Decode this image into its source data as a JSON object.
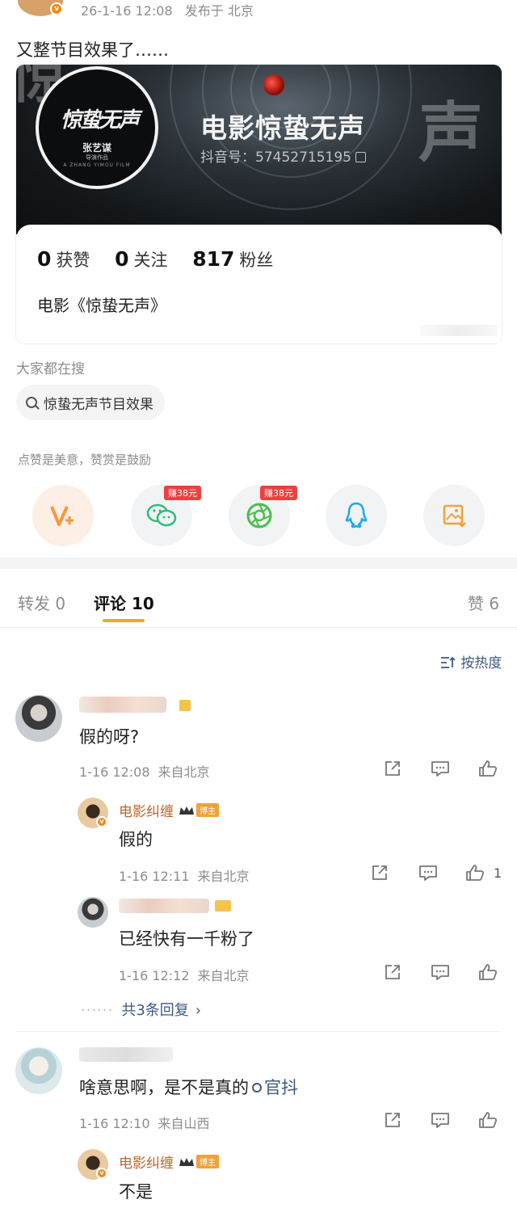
{
  "post": {
    "date": "26-1-16 12:08",
    "location": "发布于 北京",
    "text": "又整节目效果了……"
  },
  "card": {
    "logo_title": "惊蛰无声",
    "logo_director": "张艺谋",
    "logo_subtitle": "导演作品",
    "logo_en": "A ZHANG YIMOU FILM",
    "account_name": "电影惊蛰无声",
    "account_id": "抖音号：57452715195",
    "stats": [
      {
        "value": "0",
        "label": "获赞"
      },
      {
        "value": "0",
        "label": "关注"
      },
      {
        "value": "817",
        "label": "粉丝"
      }
    ],
    "description": "电影《惊蛰无声》"
  },
  "search": {
    "label": "大家都在搜",
    "query": "惊蛰无声节目效果"
  },
  "reward": {
    "text": "点赞是美意，赞赏是鼓励",
    "earn_badge": "赚38元",
    "buttons": [
      "v-plus-icon",
      "wechat-icon",
      "moments-icon",
      "qq-icon",
      "save-image-icon"
    ]
  },
  "tabs": {
    "repost": "转发 0",
    "comments": "评论 10",
    "likes": "赞 6"
  },
  "sort_label": "按热度",
  "comments": [
    {
      "text": "假的呀?",
      "date": "1-16 12:08",
      "from": "来自北京",
      "replies": [
        {
          "name": "电影纠缠",
          "badge": "博主",
          "text": "假的",
          "date": "1-16 12:11",
          "from": "来自北京",
          "likes": "1"
        },
        {
          "text": "已经快有一千粉了",
          "date": "1-16 12:12",
          "from": "来自北京",
          "likes": ""
        }
      ],
      "more_replies": "共3条回复"
    },
    {
      "text": "啥意思啊，是不是真的",
      "link": "官抖",
      "date": "1-16 12:10",
      "from": "来自山西",
      "replies": [
        {
          "name": "电影纠缠",
          "badge": "博主",
          "text": "不是"
        }
      ]
    }
  ],
  "colors": {
    "accent": "#f5a623",
    "link": "#3d5a80",
    "host_name": "#c0652a"
  }
}
